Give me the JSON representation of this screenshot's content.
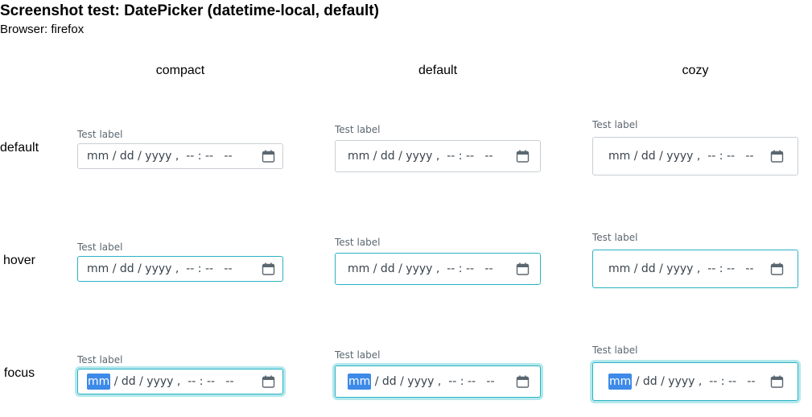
{
  "title": "Screenshot test: DatePicker (datetime-local, default)",
  "browser_line": "Browser: firefox",
  "columns": [
    "compact",
    "default",
    "cozy"
  ],
  "rows": [
    "default",
    "hover",
    "focus"
  ],
  "field": {
    "label": "Test label",
    "mm": "mm",
    "rest": " / dd / yyyy ,  -- : --   --",
    "icon": "calendar-icon"
  },
  "colors": {
    "border": "#c9cfd4",
    "accent": "#2bb2c4",
    "focus_ring": "#b3e8ec",
    "selection": "#3d8ae8"
  }
}
